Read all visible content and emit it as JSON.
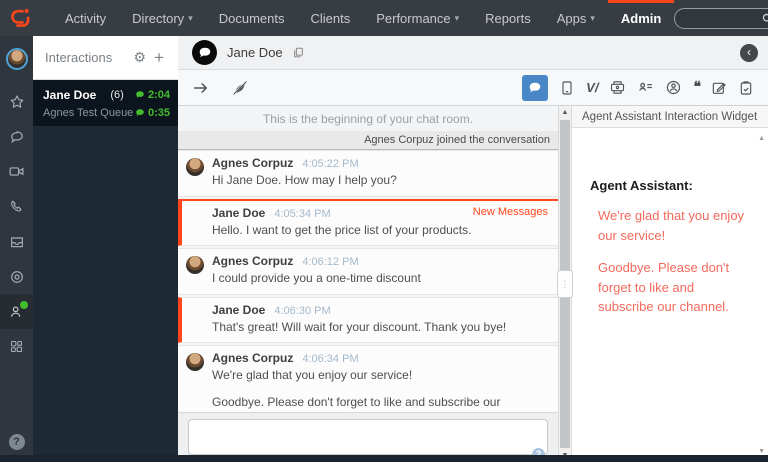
{
  "colors": {
    "accent_orange": "#ff451a",
    "active_blue": "#4a87c7",
    "status_green": "#46bc2f",
    "assistant_text": "#f4695c"
  },
  "nav": {
    "items": [
      {
        "label": "Activity"
      },
      {
        "label": "Directory",
        "caret": true
      },
      {
        "label": "Documents"
      },
      {
        "label": "Clients"
      },
      {
        "label": "Performance",
        "caret": true
      },
      {
        "label": "Reports"
      },
      {
        "label": "Apps",
        "caret": true
      },
      {
        "label": "Admin",
        "active": true
      }
    ],
    "search": {
      "value": "",
      "placeholder": ""
    },
    "icons": [
      "genesys-logo",
      "search-icon",
      "bell-icon",
      "kebab-menu-icon"
    ]
  },
  "rail": {
    "icons": [
      "profile-avatar",
      "star-icon",
      "chat-icon",
      "video-icon",
      "phone-icon",
      "inbox-icon",
      "dial-icon",
      "agent-status-icon",
      "apps-icon",
      "help-icon"
    ],
    "help_label": "?"
  },
  "interactions": {
    "title": "Interactions",
    "card": {
      "name": "Jane Doe",
      "count": "(6)",
      "duration": "2:04",
      "queue": "Agnes Test Queue",
      "queue_duration": "0:35"
    }
  },
  "chat": {
    "contact_name": "Jane Doe",
    "intro": "This is the beginning of your chat room.",
    "joined_notice": "Agnes Corpuz joined the conversation",
    "new_messages_label": "New Messages",
    "messages": [
      {
        "author": "Agnes Corpuz",
        "time": "4:05:22 PM",
        "text": "Hi Jane Doe. How may I help you?"
      },
      {
        "author": "Jane Doe",
        "time": "4:05:34 PM",
        "text": "Hello. I want to get the price list of your products."
      },
      {
        "author": "Agnes Corpuz",
        "time": "4:06:12 PM",
        "text": "I could provide you a one-time discount"
      },
      {
        "author": "Jane Doe",
        "time": "4:06:30 PM",
        "text": "That's great! Will wait for your discount. Thank you bye!"
      },
      {
        "author": "Agnes Corpuz",
        "time": "4:06:34 PM",
        "text": "We're glad that you enjoy our service!",
        "text2": "Goodbye. Please don't forget to like and subscribe our channel."
      }
    ],
    "input_value": "",
    "toolbar_icons": [
      "transfer-arrow-icon",
      "end-chat-icon",
      "chat-tool-icon",
      "mobile-tool-icon",
      "journey-tool-icon",
      "script-tool-icon",
      "contact-tool-icon",
      "profile-tool-icon",
      "responses-tool-icon",
      "notes-tool-icon",
      "wrapup-tool-icon"
    ]
  },
  "assistant_panel": {
    "title": "Agent Assistant Interaction Widget",
    "heading": "Agent Assistant:",
    "suggestions": [
      "We're glad that you enjoy our service!",
      "Goodbye. Please don't forget to like and subscribe our channel."
    ]
  }
}
